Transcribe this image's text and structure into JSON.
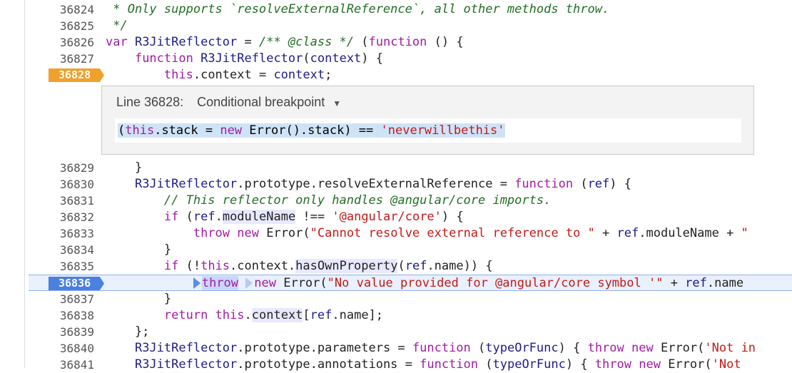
{
  "editor": {
    "lines_top": [
      {
        "num": "36824",
        "code": [
          {
            "t": " * Only supports `resolveExternalReference`, all other methods throw.",
            "c": "cm"
          }
        ]
      },
      {
        "num": "36825",
        "code": [
          {
            "t": " */",
            "c": "cm"
          }
        ]
      },
      {
        "num": "36826",
        "code": [
          {
            "t": "var ",
            "c": "kw"
          },
          {
            "t": "R3JitReflector",
            "c": "fn"
          },
          {
            "t": " = ",
            "c": ""
          },
          {
            "t": "/** @class */",
            "c": "cm"
          },
          {
            "t": " (",
            "c": ""
          },
          {
            "t": "function",
            "c": "kw"
          },
          {
            "t": " () {",
            "c": ""
          }
        ]
      },
      {
        "num": "36827",
        "code": [
          {
            "t": "    ",
            "c": ""
          },
          {
            "t": "function",
            "c": "kw"
          },
          {
            "t": " ",
            "c": ""
          },
          {
            "t": "R3JitReflector",
            "c": "fn"
          },
          {
            "t": "(",
            "c": ""
          },
          {
            "t": "context",
            "c": "prop"
          },
          {
            "t": ") {",
            "c": ""
          }
        ]
      },
      {
        "num": "36828",
        "breakpoint": "orange",
        "code": [
          {
            "t": "        ",
            "c": ""
          },
          {
            "t": "this",
            "c": "kw"
          },
          {
            "t": ".context = ",
            "c": ""
          },
          {
            "t": "context",
            "c": "prop"
          },
          {
            "t": ";",
            "c": ""
          }
        ]
      }
    ],
    "lines_bottom": [
      {
        "num": "36829",
        "code": [
          {
            "t": "    }",
            "c": ""
          }
        ]
      },
      {
        "num": "36830",
        "code": [
          {
            "t": "    ",
            "c": ""
          },
          {
            "t": "R3JitReflector",
            "c": "fn"
          },
          {
            "t": ".prototype.resolveExternalReference = ",
            "c": ""
          },
          {
            "t": "function",
            "c": "kw"
          },
          {
            "t": " (",
            "c": ""
          },
          {
            "t": "ref",
            "c": "prop"
          },
          {
            "t": ") {",
            "c": ""
          }
        ]
      },
      {
        "num": "36831",
        "code": [
          {
            "t": "        ",
            "c": ""
          },
          {
            "t": "// This reflector only handles @angular/core imports.",
            "c": "cm"
          }
        ]
      },
      {
        "num": "36832",
        "code": [
          {
            "t": "        ",
            "c": ""
          },
          {
            "t": "if",
            "c": "kw"
          },
          {
            "t": " (",
            "c": ""
          },
          {
            "t": "ref",
            "c": "prop"
          },
          {
            "t": ".",
            "c": ""
          },
          {
            "t": "moduleName",
            "c": "hl"
          },
          {
            "t": " !== ",
            "c": ""
          },
          {
            "t": "'@angular/core'",
            "c": "str"
          },
          {
            "t": ") {",
            "c": ""
          }
        ]
      },
      {
        "num": "36833",
        "code": [
          {
            "t": "            ",
            "c": ""
          },
          {
            "t": "throw",
            "c": "kw"
          },
          {
            "t": " ",
            "c": ""
          },
          {
            "t": "new",
            "c": "kw"
          },
          {
            "t": " Error(",
            "c": ""
          },
          {
            "t": "\"Cannot resolve external reference to \"",
            "c": "str"
          },
          {
            "t": " + ",
            "c": ""
          },
          {
            "t": "ref",
            "c": "prop"
          },
          {
            "t": ".moduleName + ",
            "c": ""
          },
          {
            "t": "\"",
            "c": "str"
          }
        ]
      },
      {
        "num": "36834",
        "code": [
          {
            "t": "        }",
            "c": ""
          }
        ]
      },
      {
        "num": "36835",
        "code": [
          {
            "t": "        ",
            "c": ""
          },
          {
            "t": "if",
            "c": "kw"
          },
          {
            "t": " (!",
            "c": ""
          },
          {
            "t": "this",
            "c": "kw"
          },
          {
            "t": ".context.",
            "c": ""
          },
          {
            "t": "hasOwnProperty",
            "c": "hl"
          },
          {
            "t": "(",
            "c": ""
          },
          {
            "t": "ref",
            "c": "prop"
          },
          {
            "t": ".name)) {",
            "c": ""
          }
        ]
      },
      {
        "num": "36836",
        "breakpoint": "blue",
        "exec": true,
        "code": [
          {
            "t": "            ",
            "c": ""
          },
          {
            "t": "throw",
            "c": "kw exec-hl"
          },
          {
            "t": " ",
            "c": ""
          },
          {
            "t": "new",
            "c": "kw"
          },
          {
            "t": " Error(",
            "c": ""
          },
          {
            "t": "\"No value provided for @angular/core symbol '\"",
            "c": "str"
          },
          {
            "t": " + ",
            "c": ""
          },
          {
            "t": "ref",
            "c": "prop"
          },
          {
            "t": ".name",
            "c": ""
          }
        ]
      },
      {
        "num": "36837",
        "code": [
          {
            "t": "        }",
            "c": ""
          }
        ]
      },
      {
        "num": "36838",
        "code": [
          {
            "t": "        ",
            "c": ""
          },
          {
            "t": "return",
            "c": "kw"
          },
          {
            "t": " ",
            "c": ""
          },
          {
            "t": "this",
            "c": "kw"
          },
          {
            "t": ".",
            "c": ""
          },
          {
            "t": "context",
            "c": "hl"
          },
          {
            "t": "[",
            "c": ""
          },
          {
            "t": "ref",
            "c": "prop"
          },
          {
            "t": ".name];",
            "c": ""
          }
        ]
      },
      {
        "num": "36839",
        "code": [
          {
            "t": "    };",
            "c": ""
          }
        ]
      },
      {
        "num": "36840",
        "code": [
          {
            "t": "    ",
            "c": ""
          },
          {
            "t": "R3JitReflector",
            "c": "fn"
          },
          {
            "t": ".prototype.parameters = ",
            "c": ""
          },
          {
            "t": "function",
            "c": "kw"
          },
          {
            "t": " (",
            "c": ""
          },
          {
            "t": "typeOrFunc",
            "c": "prop"
          },
          {
            "t": ") { ",
            "c": ""
          },
          {
            "t": "throw",
            "c": "kw"
          },
          {
            "t": " ",
            "c": ""
          },
          {
            "t": "new",
            "c": "kw"
          },
          {
            "t": " Error(",
            "c": ""
          },
          {
            "t": "'Not in",
            "c": "str"
          }
        ]
      },
      {
        "num": "36841",
        "code": [
          {
            "t": "    ",
            "c": ""
          },
          {
            "t": "R3JitReflector",
            "c": "fn"
          },
          {
            "t": ".prototype.annotations = ",
            "c": ""
          },
          {
            "t": "function",
            "c": "kw"
          },
          {
            "t": " (",
            "c": ""
          },
          {
            "t": "typeOrFunc",
            "c": "prop"
          },
          {
            "t": ") { ",
            "c": ""
          },
          {
            "t": "throw",
            "c": "kw"
          },
          {
            "t": " ",
            "c": ""
          },
          {
            "t": "new",
            "c": "kw"
          },
          {
            "t": " Error(",
            "c": ""
          },
          {
            "t": "'Not",
            "c": "str"
          }
        ]
      }
    ]
  },
  "breakpoint_editor": {
    "line_label": "Line 36828:",
    "type_label": "Conditional breakpoint",
    "type_caret": "▼",
    "condition_parts": [
      {
        "t": "(",
        "c": ""
      },
      {
        "t": "this",
        "c": "kw"
      },
      {
        "t": ".stack = ",
        "c": ""
      },
      {
        "t": "new",
        "c": "kw"
      },
      {
        "t": " Error().stack) == ",
        "c": ""
      },
      {
        "t": "'neverwillbethis'",
        "c": "str"
      }
    ]
  }
}
